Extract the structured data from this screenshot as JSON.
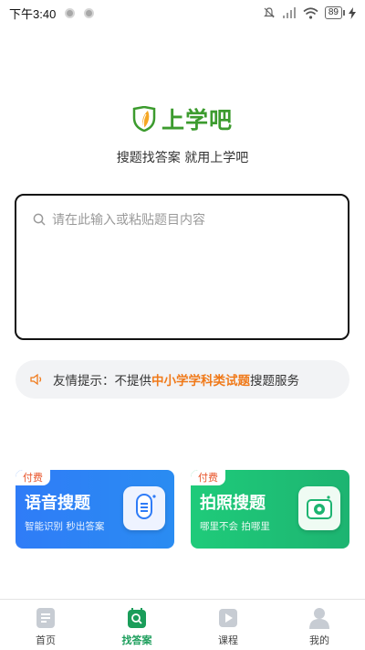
{
  "status_bar": {
    "time": "下午3:40",
    "battery": "89"
  },
  "logo": {
    "text": "上学吧"
  },
  "slogan": "搜题找答案 就用上学吧",
  "search": {
    "placeholder": "请在此输入或粘贴题目内容"
  },
  "notice": {
    "prefix": "友情提示：不提供",
    "highlight": "中小学学科类试题",
    "suffix": "搜题服务"
  },
  "cards": [
    {
      "badge": "付费",
      "title": "语音搜题",
      "subtitle": "智能识别 秒出答案",
      "icon": "microphone-icon",
      "color": "#2f7cf7"
    },
    {
      "badge": "付费",
      "title": "拍照搜题",
      "subtitle": "哪里不会 拍哪里",
      "icon": "camera-icon",
      "color": "#1fcb7a"
    }
  ],
  "tabs": [
    {
      "label": "首页",
      "icon": "document-icon",
      "active": false
    },
    {
      "label": "找答案",
      "icon": "search-answer-icon",
      "active": true
    },
    {
      "label": "课程",
      "icon": "play-icon",
      "active": false
    },
    {
      "label": "我的",
      "icon": "user-icon",
      "active": false
    }
  ],
  "colors": {
    "brand_green": "#3c9b2e",
    "highlight_orange": "#f07a1a",
    "active_tab": "#1a9d5a"
  }
}
